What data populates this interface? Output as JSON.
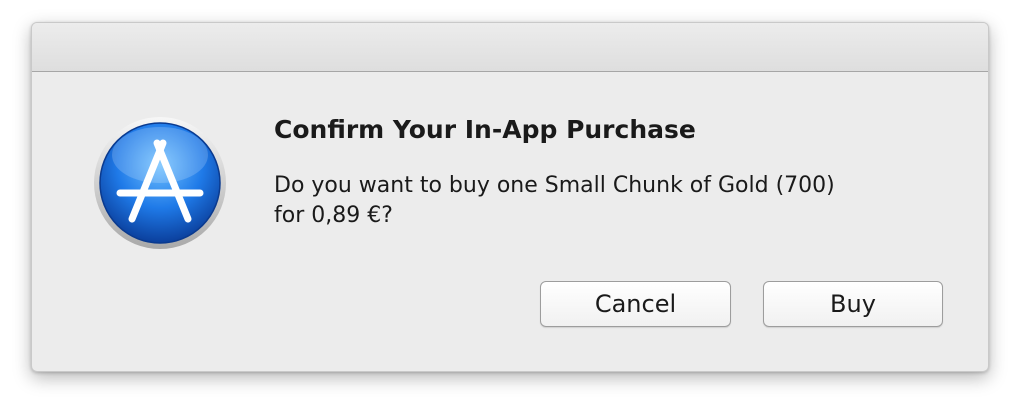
{
  "dialog": {
    "icon": "app-store-icon",
    "title": "Confirm Your In-App Purchase",
    "message_line1": "Do you want to buy one Small Chunk of Gold (700)",
    "message_line2": "for 0,89 €?",
    "cancel_label": "Cancel",
    "buy_label": "Buy"
  },
  "colors": {
    "icon_blue": "#1d6fe0",
    "dialog_bg": "#ececec"
  }
}
